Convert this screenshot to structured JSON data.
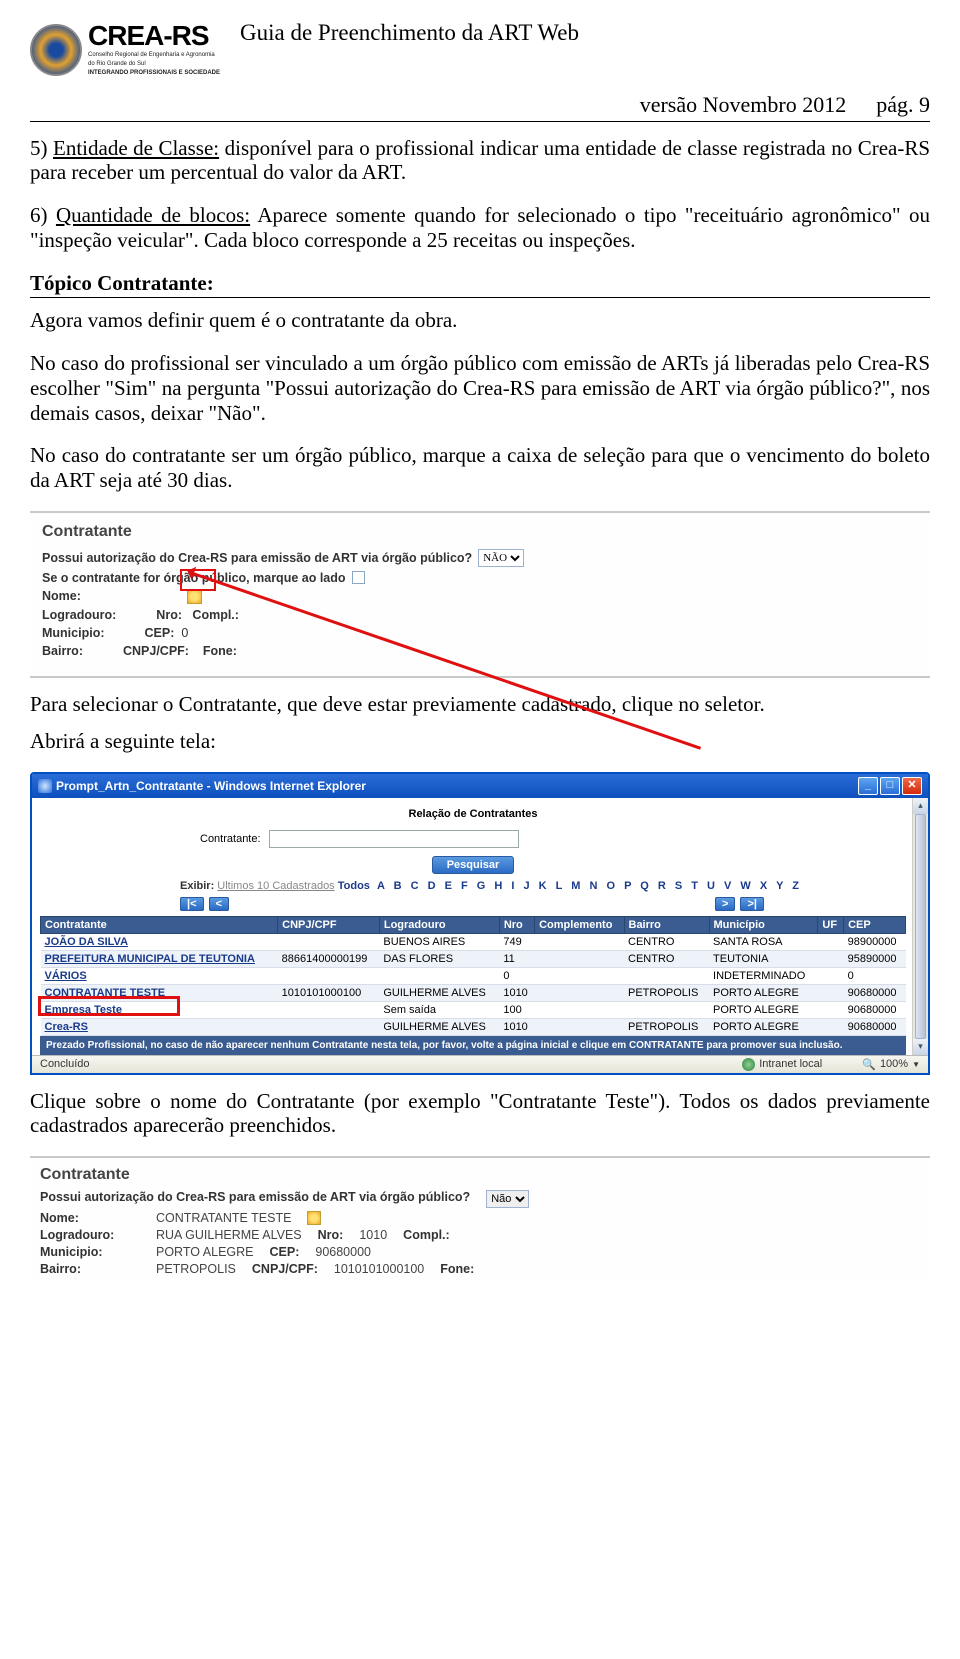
{
  "header": {
    "logo_main": "CREA-RS",
    "logo_sub1": "Conselho Regional de Engenharia e Agronomia",
    "logo_sub2": "do Rio Grande do Sul",
    "logo_sub3": "INTEGRANDO PROFISSIONAIS E SOCIEDADE",
    "page_title": "Guia de Preenchimento da ART Web",
    "version": "versão Novembro 2012",
    "page_num": "pág. 9"
  },
  "body": {
    "p1_lead": "5) ",
    "p1_u": "Entidade de Classe:",
    "p1_rest": " disponível para o profissional indicar uma entidade de classe registrada no Crea-RS para receber um percentual do valor da ART.",
    "p2_lead": "6) ",
    "p2_u": "Quantidade de blocos:",
    "p2_rest": " Aparece somente quando for selecionado o tipo \"receituário agronômico\" ou \"inspeção veicular\". Cada bloco corresponde a 25 receitas ou inspeções.",
    "sec_head": "Tópico Contratante:",
    "p3": "Agora vamos definir quem é o contratante da obra.",
    "p4": "No caso do profissional ser vinculado a um órgão público com emissão de ARTs já liberadas pelo Crea-RS escolher \"Sim\" na pergunta \"Possui autorização do Crea-RS para emissão de ART via órgão público?\", nos demais casos, deixar \"Não\".",
    "p5": "No caso do contratante ser um órgão público, marque a caixa de seleção para que o vencimento do boleto da ART seja até 30 dias.",
    "p6": "Para selecionar o Contratante, que deve estar previamente cadastrado, clique no seletor.",
    "p7": "Abrirá a seguinte tela:",
    "p8": "Clique sobre o nome do Contratante (por exemplo \"Contratante Teste\"). Todos os dados previamente cadastrados aparecerão preenchidos."
  },
  "ss1": {
    "title": "Contratante",
    "q1_label": "Possui autorização do Crea-RS para emissão de ART via órgão público?",
    "q1_value": "NÃO",
    "q2_label": "Se o contratante for órgão público, marque ao lado",
    "nome_lbl": "Nome:",
    "logradouro_lbl": "Logradouro:",
    "nro_lbl": "Nro:",
    "compl_lbl": "Compl.:",
    "municipio_lbl": "Municipio:",
    "cep_lbl": "CEP:",
    "cep_val": "0",
    "bairro_lbl": "Bairro:",
    "cnpj_lbl": "CNPJ/CPF:",
    "fone_lbl": "Fone:"
  },
  "ss2": {
    "title": "Contratante",
    "q1_label": "Possui autorização do Crea-RS para emissão de ART via órgão público?",
    "q1_value": "Não",
    "nome_lbl": "Nome:",
    "nome_val": "CONTRATANTE TESTE",
    "logradouro_lbl": "Logradouro:",
    "logradouro_val": "RUA  GUILHERME ALVES",
    "nro_lbl": "Nro:",
    "nro_val": "1010",
    "compl_lbl": "Compl.:",
    "municipio_lbl": "Municipio:",
    "municipio_val": "PORTO ALEGRE",
    "cep_lbl": "CEP:",
    "cep_val": "90680000",
    "bairro_lbl": "Bairro:",
    "bairro_val": "PETROPOLIS",
    "cnpj_lbl": "CNPJ/CPF:",
    "cnpj_val": "1010101000100",
    "fone_lbl": "Fone:"
  },
  "ie": {
    "window_title": "Prompt_Artn_Contratante - Windows Internet Explorer",
    "heading": "Relação de Contratantes",
    "search_label": "Contratante:",
    "search_btn": "Pesquisar",
    "exibir_lbl": "Exibir:",
    "exibir_grey": "Ultimos 10 Cadastrados",
    "exibir_todos": "Todos",
    "exibir_az": "A B C D E F G H I J K L M N O P Q R S T U V W X Y Z",
    "pager_first": "|<",
    "pager_prev": "<",
    "pager_next": ">",
    "pager_last": ">|",
    "cols": [
      "Contratante",
      "CNPJ/CPF",
      "Logradouro",
      "Nro",
      "Complemento",
      "Bairro",
      "Município",
      "UF",
      "CEP"
    ],
    "rows": [
      {
        "c": "JOÃO DA SILVA",
        "cnpj": "",
        "log": "BUENOS AIRES",
        "nro": "749",
        "comp": "",
        "bai": "CENTRO",
        "mun": "SANTA ROSA",
        "uf": "",
        "cep": "98900000"
      },
      {
        "c": "PREFEITURA MUNICIPAL DE TEUTONIA",
        "cnpj": "88661400000199",
        "log": "DAS FLORES",
        "nro": "11",
        "comp": "",
        "bai": "CENTRO",
        "mun": "TEUTONIA",
        "uf": "",
        "cep": "95890000"
      },
      {
        "c": "VÁRIOS",
        "cnpj": "",
        "log": "",
        "nro": "0",
        "comp": "",
        "bai": "",
        "mun": "INDETERMINADO",
        "uf": "",
        "cep": "0"
      },
      {
        "c": "CONTRATANTE TESTE",
        "cnpj": "1010101000100",
        "log": "GUILHERME ALVES",
        "nro": "1010",
        "comp": "",
        "bai": "PETROPOLIS",
        "mun": "PORTO ALEGRE",
        "uf": "",
        "cep": "90680000"
      },
      {
        "c": "Empresa Teste",
        "cnpj": "",
        "log": "Sem saída",
        "nro": "100",
        "comp": "",
        "bai": "",
        "mun": "PORTO ALEGRE",
        "uf": "",
        "cep": "90680000"
      },
      {
        "c": "Crea-RS",
        "cnpj": "",
        "log": "GUILHERME ALVES",
        "nro": "1010",
        "comp": "",
        "bai": "PETROPOLIS",
        "mun": "PORTO ALEGRE",
        "uf": "",
        "cep": "90680000"
      }
    ],
    "note": "Prezado Profissional, no caso de não aparecer nenhum Contratante nesta tela, por favor, volte a página inicial e clique em CONTRATANTE para promover sua inclusão.",
    "status_done": "Concluído",
    "status_zone": "Intranet local",
    "status_zoom": "100%"
  }
}
